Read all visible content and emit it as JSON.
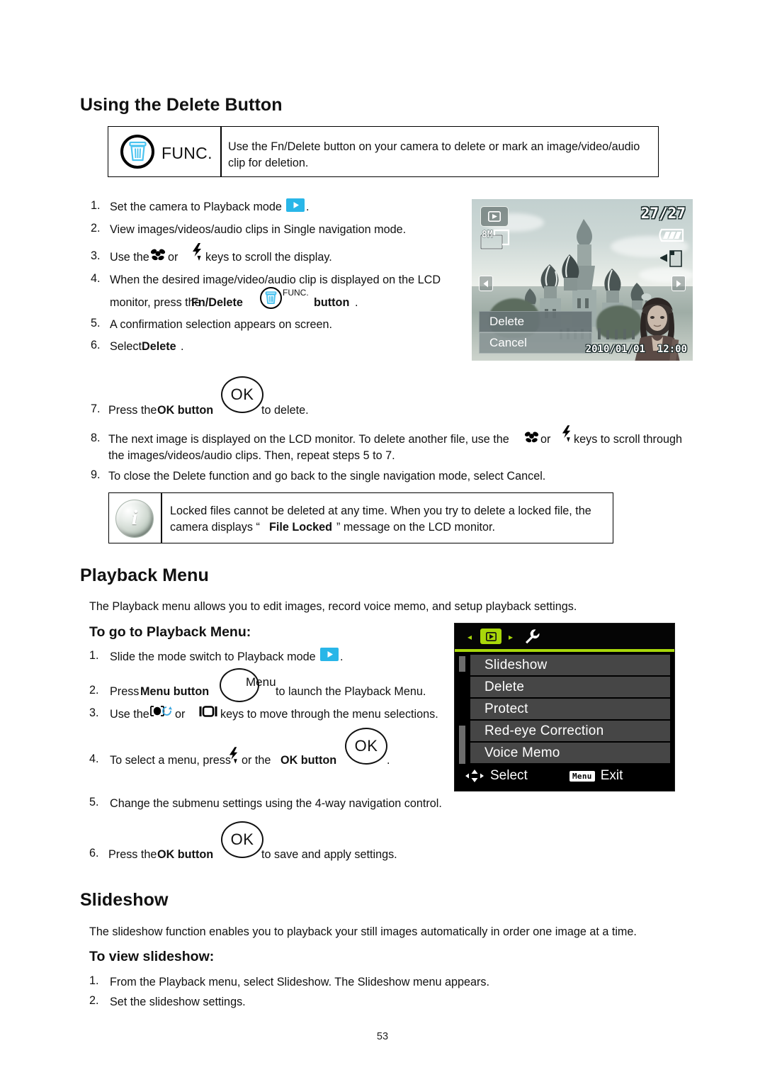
{
  "page": {
    "number": "53"
  },
  "section_delete": {
    "heading": "Using the Delete Button",
    "func_box": {
      "icon_label": "FUNC.",
      "text": "Use the Fn/Delete button on your camera to delete or mark an image/video/audio clip for deletion."
    },
    "steps": [
      {
        "num": "1.",
        "parts": [
          "Set the camera to Playback mode ",
          "",
          "."
        ]
      },
      {
        "num": "2.",
        "text": "View images/videos/audio clips in Single navigation mode."
      },
      {
        "num": "3.",
        "pre": "Use the ",
        "mid": " or ",
        "post": " keys to scroll the display."
      },
      {
        "num": "4.",
        "line1": "When the desired image/video/audio clip is displayed on the LCD",
        "line2_pre": "monitor, press the ",
        "line2_bold": "Fn/Delete",
        "line2_func": "FUNC.",
        "line2_post": "button",
        "line2_end": "."
      },
      {
        "num": "5.",
        "text": "A confirmation selection appears on screen."
      },
      {
        "num": "6.",
        "pre": "Select ",
        "bold": "Delete",
        "post": "."
      },
      {
        "num": "7.",
        "pre": "Press the ",
        "bold": "OK button",
        "post": " to delete.",
        "button": "OK"
      },
      {
        "num": "8.",
        "pre": "The next image is displayed on the LCD monitor. To delete another file, use the ",
        "mid": " or ",
        "post": " keys to scroll through",
        "line2": "the images/videos/audio clips. Then, repeat steps 5 to 7."
      },
      {
        "num": "9.",
        "text": "To close the Delete function and go back to the single navigation mode, select Cancel."
      }
    ],
    "note": {
      "pre": "Locked files cannot be deleted at any time. When you try to delete a locked file, the",
      "line2_pre": "camera displays “",
      "line2_bold": "File Locked",
      "line2_post": "” message on the LCD monitor."
    }
  },
  "lcd_photo": {
    "mode_icon": "playback-mode-icon",
    "resolution": "8M",
    "counter": "27/27",
    "battery_icon": "battery-full-icon",
    "card_icon": "sd-card-icon",
    "left_arrow": "‹",
    "right_arrow": "›",
    "dialog": {
      "option_delete": "Delete",
      "option_cancel": "Cancel"
    },
    "date": "2010/01/01",
    "time": "12:00"
  },
  "section_playback_menu": {
    "heading": "Playback Menu",
    "intro": "The Playback menu allows you to edit images, record voice memo, and setup playback settings.",
    "subheading": "To go to Playback Menu:",
    "steps": [
      {
        "num": "1.",
        "pre": "Slide the mode switch to Playback mode ",
        "post": "."
      },
      {
        "num": "2.",
        "pre": "Press ",
        "bold": "Menu button",
        "button_label": "Menu",
        "post": " to launch the Playback Menu."
      },
      {
        "num": "3.",
        "pre": "Use the ",
        "mid": " or ",
        "post": " keys to move through the menu selections."
      },
      {
        "num": "4.",
        "pre": "To select a menu, press ",
        "mid": " or the ",
        "bold": "OK button",
        "button": "OK",
        "post": "."
      },
      {
        "num": "5.",
        "text": "Change the submenu settings using the 4-way navigation control."
      },
      {
        "num": "6.",
        "pre": "Press the ",
        "bold": "OK button",
        "button": "OK",
        "post": " to save and apply settings."
      }
    ]
  },
  "lcd_menu": {
    "tab_left_arrow": "◂",
    "tab_playback_icon": "playback-tab-icon",
    "tab_right_arrow": "▸",
    "tab_setup_icon": "wrench-icon",
    "items": [
      "Slideshow",
      "Delete",
      "Protect",
      "Red-eye Correction",
      "Voice Memo"
    ],
    "footer": {
      "select_label": "Select",
      "exit_badge": "Menu",
      "exit_label": "Exit"
    },
    "accent_color": "#a8d70a"
  },
  "section_slideshow": {
    "heading": "Slideshow",
    "intro": "The slideshow function enables you to playback your still images automatically in order one image at a time.",
    "subheading": "To view slideshow:",
    "steps": [
      {
        "num": "1.",
        "text": "From the Playback menu, select Slideshow. The Slideshow menu appears."
      },
      {
        "num": "2.",
        "text": "Set the slideshow settings."
      }
    ]
  }
}
